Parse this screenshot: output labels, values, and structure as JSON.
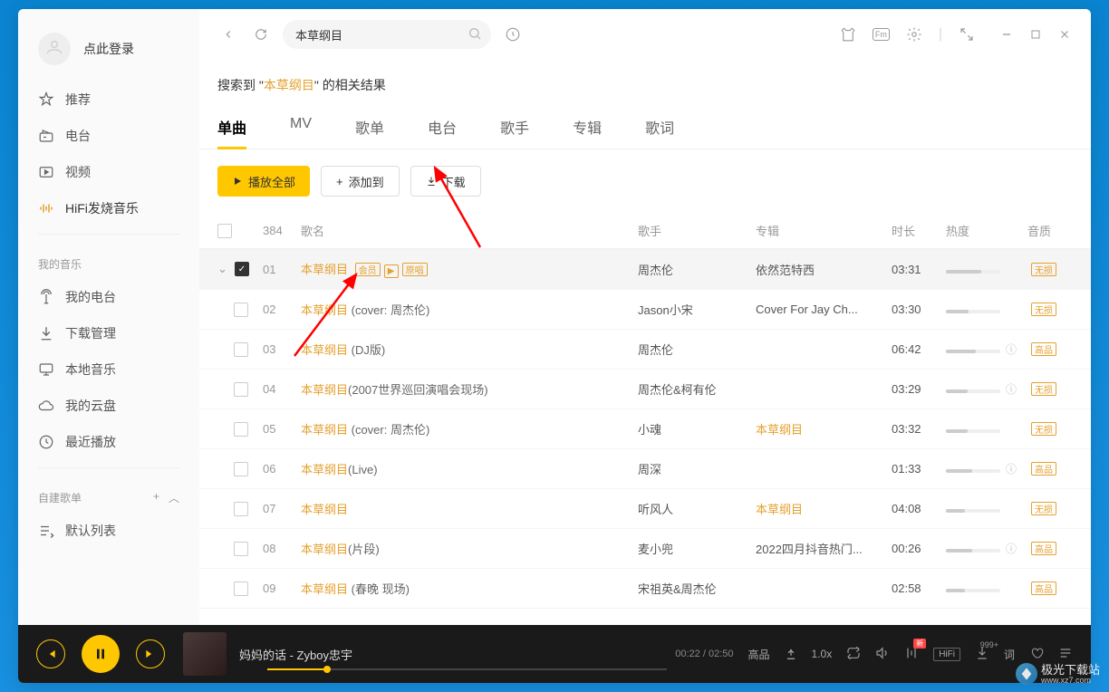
{
  "sidebar": {
    "login_text": "点此登录",
    "nav": [
      {
        "label": "推荐",
        "icon": "star"
      },
      {
        "label": "电台",
        "icon": "radio"
      },
      {
        "label": "视频",
        "icon": "video"
      },
      {
        "label": "HiFi发烧音乐",
        "icon": "hifi"
      }
    ],
    "section_my": "我的音乐",
    "my": [
      {
        "label": "我的电台",
        "icon": "broadcast"
      },
      {
        "label": "下载管理",
        "icon": "download"
      },
      {
        "label": "本地音乐",
        "icon": "monitor"
      },
      {
        "label": "我的云盘",
        "icon": "cloud"
      },
      {
        "label": "最近播放",
        "icon": "clock"
      }
    ],
    "section_playlist": "自建歌单",
    "default_list": "默认列表"
  },
  "search": {
    "value": "本草纲目",
    "result_prefix": "搜索到",
    "result_quote_l": " \"",
    "result_term": "本草纲目",
    "result_quote_r": "\" ",
    "result_suffix": "的相关结果"
  },
  "tabs": [
    "单曲",
    "MV",
    "歌单",
    "电台",
    "歌手",
    "专辑",
    "歌词"
  ],
  "active_tab": 0,
  "actions": {
    "play_all": "播放全部",
    "add_to": "添加到",
    "download": "下载"
  },
  "columns": {
    "count": "384",
    "name": "歌名",
    "artist": "歌手",
    "album": "专辑",
    "duration": "时长",
    "heat": "热度",
    "quality": "音质"
  },
  "songs": [
    {
      "idx": "01",
      "checked": true,
      "selected": true,
      "title": "本草纲目",
      "suffix": "",
      "badges": [
        "会员",
        "▶",
        "原唱"
      ],
      "artist": "周杰伦",
      "album": "依然范特西",
      "dur": "03:31",
      "heat": 65,
      "quality": "无损",
      "info": false
    },
    {
      "idx": "02",
      "checked": false,
      "title": "本草纲目",
      "suffix": " (cover: 周杰伦)",
      "artist": "Jason小宋",
      "album": "Cover For Jay Ch...",
      "dur": "03:30",
      "heat": 42,
      "quality": "无损",
      "info": false
    },
    {
      "idx": "03",
      "checked": false,
      "title": "本草纲目",
      "suffix": " (DJ版)",
      "artist": "周杰伦",
      "album": "",
      "dur": "06:42",
      "heat": 55,
      "quality": "高品",
      "info": true
    },
    {
      "idx": "04",
      "checked": false,
      "title": "本草纲目",
      "suffix": "(2007世界巡回演唱会现场)",
      "artist": "周杰伦&柯有伦",
      "album": "",
      "dur": "03:29",
      "heat": 40,
      "quality": "无损",
      "info": true
    },
    {
      "idx": "05",
      "checked": false,
      "title": "本草纲目",
      "suffix": " (cover: 周杰伦)",
      "artist": "小魂",
      "album": "本草纲目",
      "album_link": true,
      "dur": "03:32",
      "heat": 40,
      "quality": "无损",
      "info": false
    },
    {
      "idx": "06",
      "checked": false,
      "title": "本草纲目",
      "suffix": "(Live)",
      "artist": "周深",
      "album": "",
      "dur": "01:33",
      "heat": 48,
      "quality": "高品",
      "info": true
    },
    {
      "idx": "07",
      "checked": false,
      "title": "本草纲目",
      "suffix": "",
      "artist": "听风人",
      "album": "本草纲目",
      "album_link": true,
      "dur": "04:08",
      "heat": 35,
      "quality": "无损",
      "info": false
    },
    {
      "idx": "08",
      "checked": false,
      "title": "本草纲目",
      "suffix": "(片段)",
      "artist": "麦小兜",
      "album": "2022四月抖音热门...",
      "dur": "00:26",
      "heat": 48,
      "quality": "高品",
      "info": true
    },
    {
      "idx": "09",
      "checked": false,
      "title": "本草纲目",
      "suffix": " (春晚 现场)",
      "artist": "宋祖英&周杰伦",
      "album": "",
      "dur": "02:58",
      "heat": 35,
      "quality": "高品",
      "info": false
    }
  ],
  "player": {
    "title": "妈妈的话 - Zyboy忠宇",
    "time_current": "00:22",
    "time_total": "02:50",
    "progress_pct": 15,
    "quality": "高品",
    "speed": "1.0x",
    "hifi": "HiFi",
    "lyric": "词",
    "new": "新",
    "count": "999+"
  },
  "watermark": {
    "text": "极光下载站",
    "url": "www.xz7.com"
  }
}
